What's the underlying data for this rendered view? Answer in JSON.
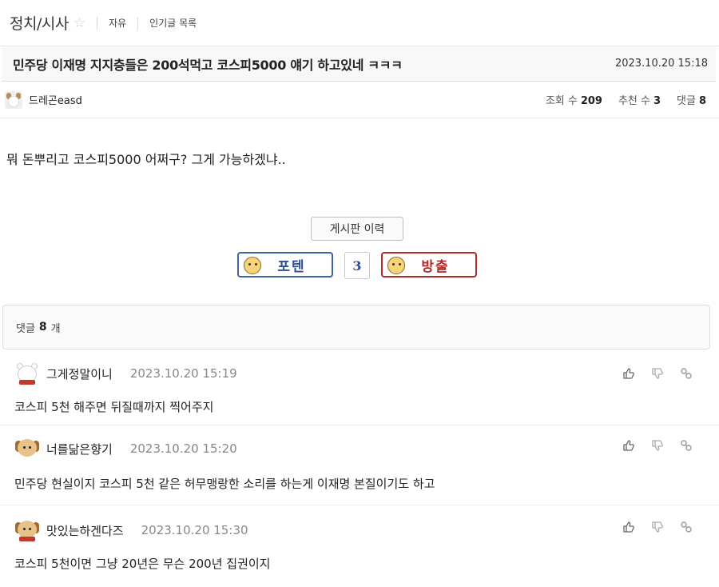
{
  "topbar": {
    "board_name": "정치/시사",
    "links": [
      "자유",
      "인기글 목록"
    ]
  },
  "post": {
    "title": "민주당 이재명 지지층들은 200석먹고 코스피5000 얘기 하고있네 ㅋㅋㅋ",
    "date": "2023.10.20 15:18",
    "author": "드레곤easd",
    "stats": {
      "views_label": "조회 수",
      "views": "209",
      "recommends_label": "추천 수",
      "recommends": "3",
      "comments_label": "댓글",
      "comments": "8"
    },
    "body": "뭐 돈뿌리고 코스피5000 어쩌구?  그게 가능하겠냐.."
  },
  "actions": {
    "history_button": "게시판 이력",
    "upvote_label": "포텐",
    "vote_count": "3",
    "downvote_label": "방출"
  },
  "comment_section": {
    "label": "댓글",
    "count": "8",
    "unit": "개"
  },
  "comments": [
    {
      "name": "그게정말이니",
      "date": "2023.10.20 15:19",
      "text": "코스피 5천 해주면 뒤질때까지 찍어주지",
      "avatar": "bear-avatar"
    },
    {
      "name": "너를닮은향기",
      "date": "2023.10.20 15:20",
      "text": "민주당 현실이지 코스피 5천 같은 허무맹랑한 소리를 하는게 이재명 본질이기도 하고",
      "avatar": "dog-avatar"
    },
    {
      "name": "맛있는하겐다즈",
      "date": "2023.10.20 15:30",
      "text": "코스피 5천이면 그냥 20년은 무슨 200년 집권이지",
      "avatar": "dog-avatar"
    }
  ],
  "icons": {
    "star": "star-icon",
    "like": "thumbs-up-icon",
    "dislike": "thumbs-down-icon",
    "link": "link-icon"
  },
  "colors": {
    "upvote": "#2a4f96",
    "downvote": "#b22a2a",
    "date_gray": "#888888"
  }
}
